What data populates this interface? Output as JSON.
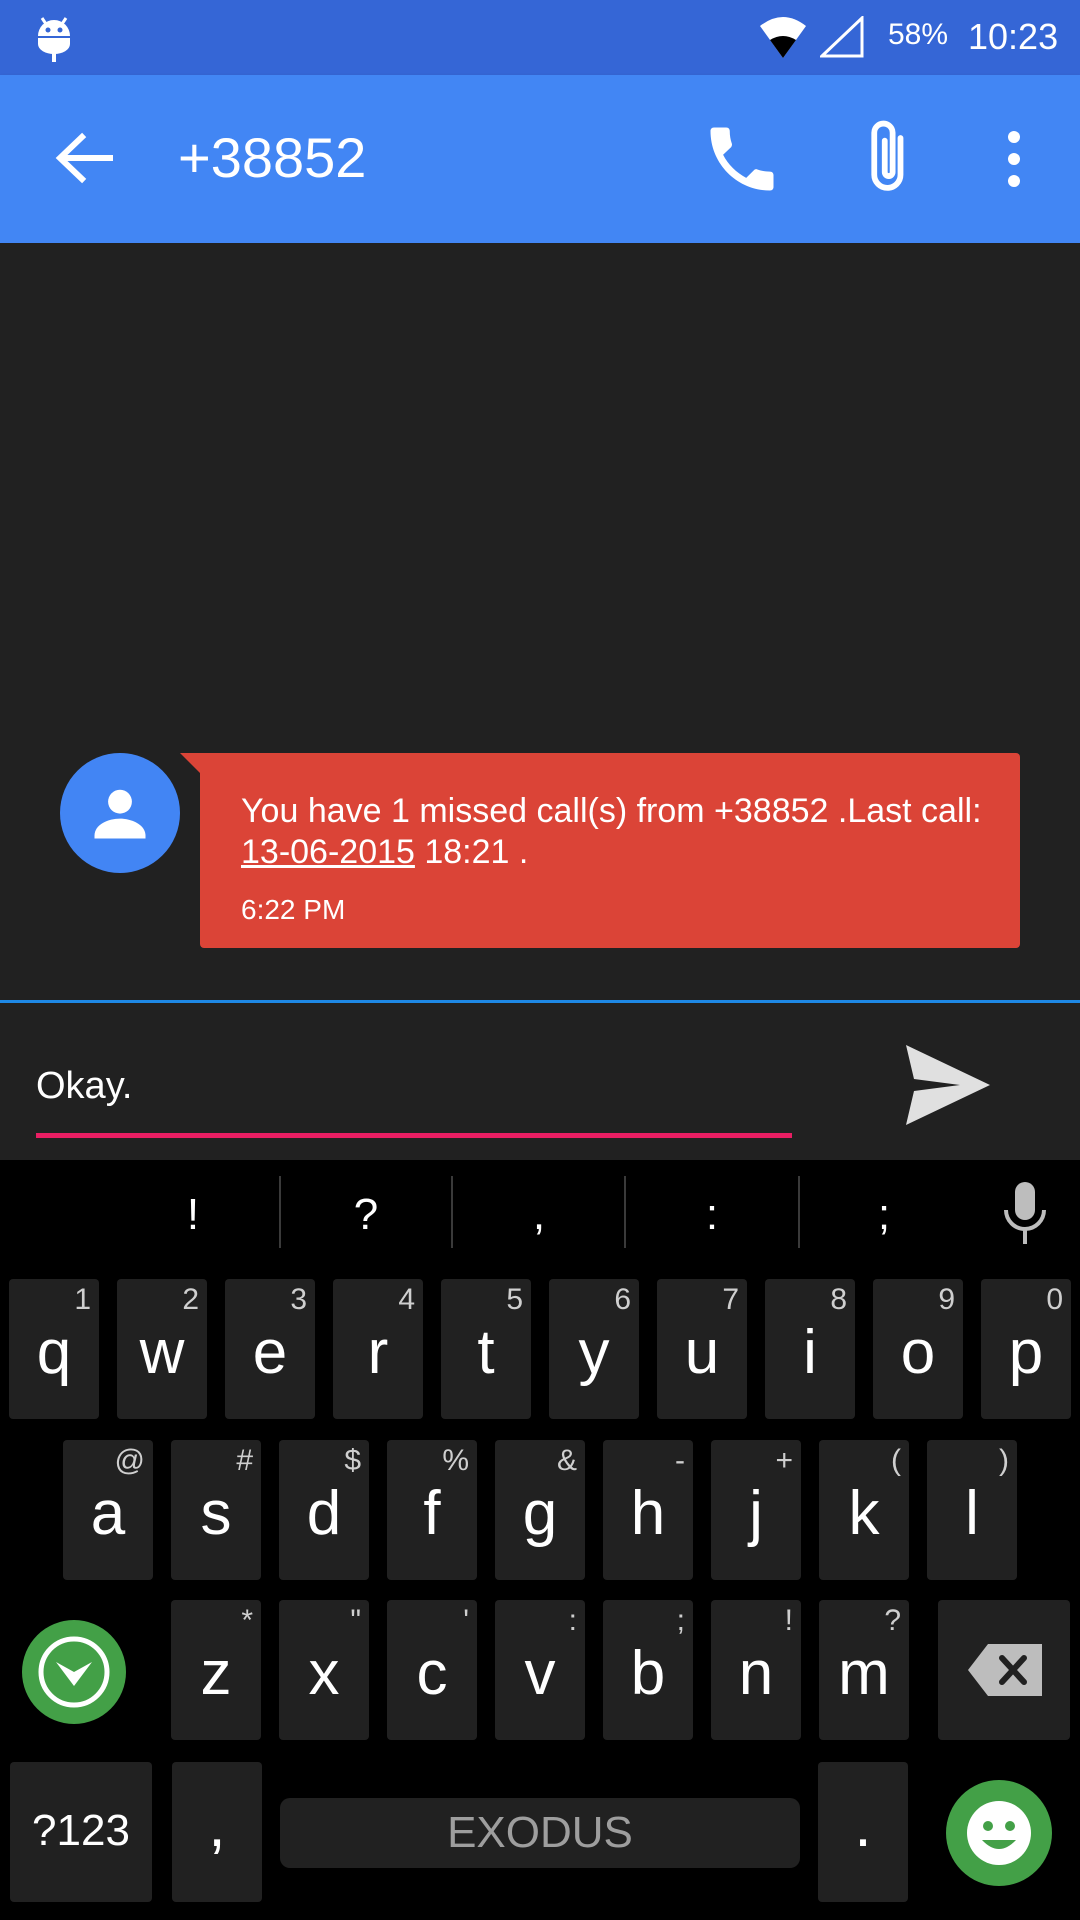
{
  "status_bar": {
    "battery": "58%",
    "time": "10:23",
    "icons": [
      "android-debug-icon",
      "wifi-icon",
      "signal-icon"
    ]
  },
  "app_bar": {
    "title": "+38852",
    "icons": [
      "back-arrow-icon",
      "phone-icon",
      "paperclip-icon",
      "more-vert-icon"
    ],
    "color": "#4286F4"
  },
  "conversation": {
    "messages": [
      {
        "text_before": "You have 1 missed call(s) from +38852 .Last call: ",
        "date_link": "13-06-2015",
        "text_after": " 18:21 .",
        "time": "6:22 PM",
        "bubble_color": "#DB4437",
        "avatar_color": "#4285F4"
      }
    ]
  },
  "compose": {
    "value": "Okay.",
    "icons": [
      "send-icon"
    ]
  },
  "keyboard": {
    "suggestions": [
      "!",
      "?",
      ",",
      ":",
      ";"
    ],
    "row1": [
      {
        "ch": "q",
        "hint": "1"
      },
      {
        "ch": "w",
        "hint": "2"
      },
      {
        "ch": "e",
        "hint": "3"
      },
      {
        "ch": "r",
        "hint": "4"
      },
      {
        "ch": "t",
        "hint": "5"
      },
      {
        "ch": "y",
        "hint": "6"
      },
      {
        "ch": "u",
        "hint": "7"
      },
      {
        "ch": "i",
        "hint": "8"
      },
      {
        "ch": "o",
        "hint": "9"
      },
      {
        "ch": "p",
        "hint": "0"
      }
    ],
    "row2": [
      {
        "ch": "a",
        "hint": "@"
      },
      {
        "ch": "s",
        "hint": "#"
      },
      {
        "ch": "d",
        "hint": "$"
      },
      {
        "ch": "f",
        "hint": "%"
      },
      {
        "ch": "g",
        "hint": "&"
      },
      {
        "ch": "h",
        "hint": "-"
      },
      {
        "ch": "j",
        "hint": "+"
      },
      {
        "ch": "k",
        "hint": "("
      },
      {
        "ch": "l",
        "hint": ")"
      }
    ],
    "row3": [
      {
        "ch": "z",
        "hint": "*"
      },
      {
        "ch": "x",
        "hint": "\""
      },
      {
        "ch": "c",
        "hint": "'"
      },
      {
        "ch": "v",
        "hint": ":"
      },
      {
        "ch": "b",
        "hint": ";"
      },
      {
        "ch": "n",
        "hint": "!"
      },
      {
        "ch": "m",
        "hint": "?"
      }
    ],
    "numbers_label": "?123",
    "comma_label": ",",
    "space_label": "EXODUS",
    "period_label": ".",
    "icons": [
      "microphone-icon",
      "keyboard-switch-icon",
      "backspace-icon",
      "emoji-icon"
    ],
    "accent_color": "#43A047"
  }
}
